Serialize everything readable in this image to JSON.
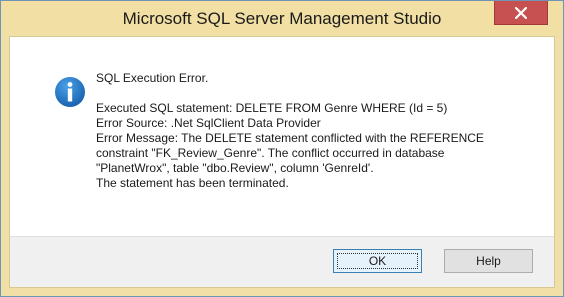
{
  "window": {
    "title": "Microsoft SQL Server Management Studio"
  },
  "icons": {
    "close": "close-icon",
    "info": "information-icon"
  },
  "colors": {
    "titlebar": "#f1dfa3",
    "close_button": "#c75050",
    "info_icon": "#1e6fbf"
  },
  "message": {
    "heading": "SQL Execution Error.",
    "lines": [
      "Executed SQL statement: DELETE FROM Genre WHERE (Id = 5)",
      "Error Source: .Net SqlClient Data Provider",
      "Error Message: The DELETE statement conflicted with the REFERENCE",
      "constraint \"FK_Review_Genre\". The conflict occurred in database",
      "\"PlanetWrox\", table \"dbo.Review\", column 'GenreId'.",
      "The statement has been terminated."
    ]
  },
  "buttons": {
    "ok": "OK",
    "help": "Help"
  }
}
